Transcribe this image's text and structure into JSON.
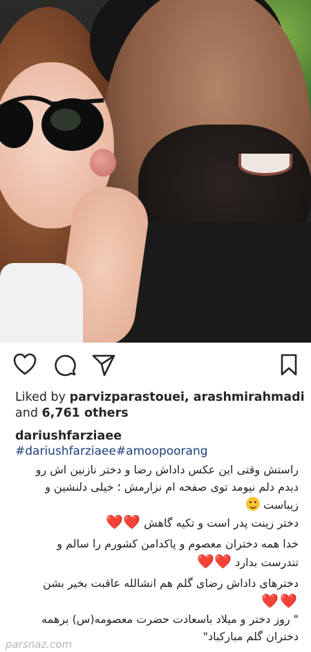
{
  "actions": {
    "like": "heart-icon",
    "comment": "comment-icon",
    "share": "send-icon",
    "save": "bookmark-icon"
  },
  "likes": {
    "prefix": "Liked by ",
    "users": "parvizparastouei, arashmirahmadi",
    "line2_prefix": "and ",
    "count": "6,761 others"
  },
  "post": {
    "username": "dariushfarziaee",
    "hashtags": "#dariushfarziaee#amoopoorang",
    "caption_lines": [
      "راستش وقتی این عکس داداش رضا و دختر نازنین اش رو",
      "دیدم دلم نیومد توی صفحه ام نزارمش ؛ خیلی دلنشین و",
      "زیباست",
      "دختر زینت پدر است و تکیه گاهش",
      "خدا همه دختران معصوم و پاکدامن کشورم را سالم و",
      "تندرست بدارد",
      "دخترهای داداش رضای گلم هم انشالله عاقبت بخیر بشن",
      "\" روز دختر و میلاد باسعادت حضرت معصومه(س) برهمه",
      "دختران گلم مبارکباد\""
    ],
    "hearts": "❤️❤️"
  },
  "watermark": "parsnaz.com",
  "colors": {
    "text": "#262626",
    "hashtag": "#1c3f7a",
    "heart": "#e0323c"
  }
}
